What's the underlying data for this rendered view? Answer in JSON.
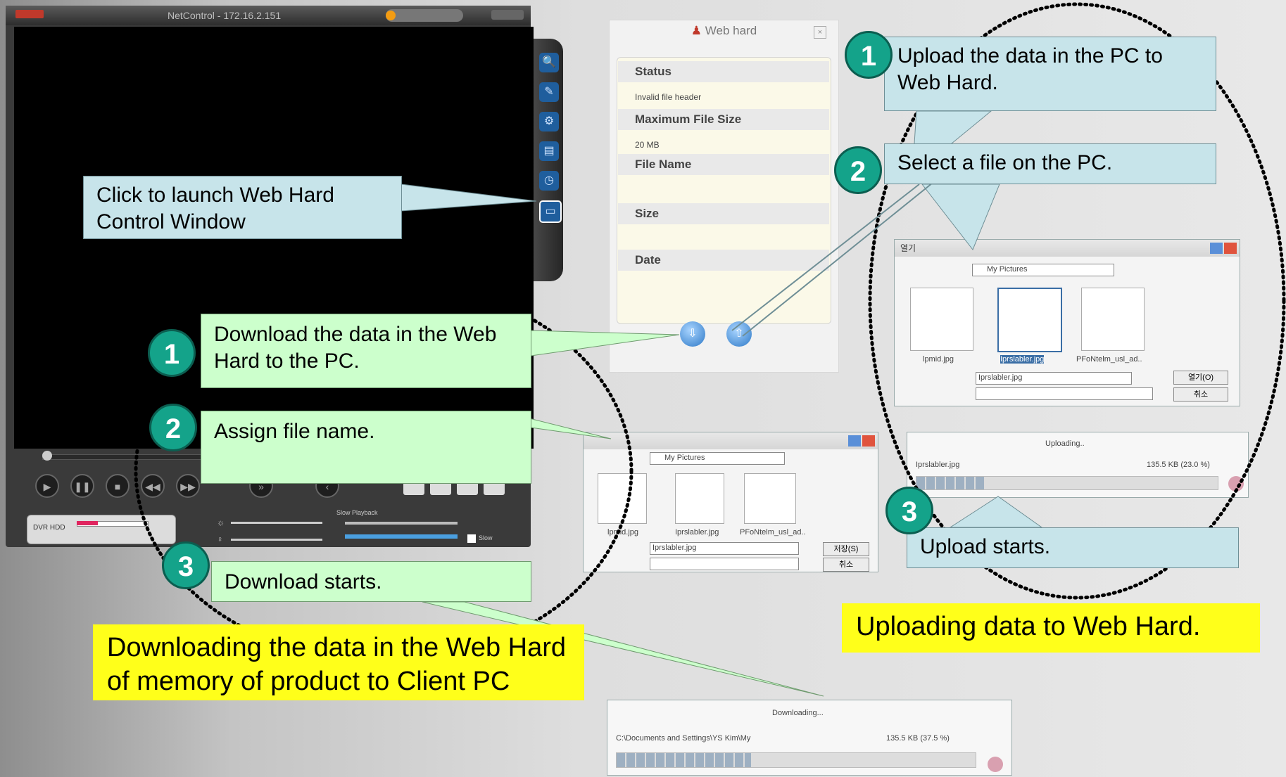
{
  "player": {
    "title": "NetControl - 172.16.2.151",
    "dvr_label": "DVR HDD",
    "eq1_label": "Slow Playback",
    "eq2_label": "Slow"
  },
  "web_hard": {
    "header": "Web hard",
    "status_label": "Status",
    "status_value": "Invalid file header",
    "max_size_label": "Maximum File Size",
    "max_size_value": "20 MB",
    "file_name_label": "File Name",
    "size_label": "Size",
    "date_label": "Date"
  },
  "upload_dialog": {
    "thumbs": [
      "lpmid.jpg",
      "Iprslabler.jpg",
      "PFoNtelm_usl_ad.."
    ],
    "filename_value": "Iprslabler.jpg",
    "open_btn": "열기(O)",
    "cancel_btn": "취소",
    "folder_value": "My Pictures"
  },
  "save_dialog": {
    "thumbs": [
      "lpmid.jpg",
      "Iprslabler.jpg",
      "PFoNtelm_usl_ad.."
    ],
    "filename_value": "Iprslabler.jpg",
    "save_btn": "저장(S)",
    "cancel_btn": "취소",
    "folder_value": "My Pictures"
  },
  "uploading_dialog": {
    "title": "Uploading..",
    "file": "Iprslabler.jpg",
    "size": "135.5 KB   (23.0 %)",
    "progress": 0.23
  },
  "downloading_dialog": {
    "title": "Downloading...",
    "file": "C:\\Documents and Settings\\YS Kim\\My",
    "size": "135.5 KB   (37.5 %)",
    "progress": 0.375
  },
  "callouts": {
    "launch": "Click to launch Web Hard Control Window",
    "upload1": "Upload the data in the PC to Web Hard.",
    "upload2": "Select a file on the PC.",
    "upload3": "Upload starts.",
    "download1": "Download the data in the Web Hard to the PC.",
    "download2": "Assign file name.",
    "download3": "Download starts."
  },
  "numbers": {
    "one": "1",
    "two": "2",
    "three": "3"
  },
  "captions": {
    "uploading": "Uploading data to Web Hard.",
    "downloading": "Downloading the data in the Web Hard of memory of product to Client PC"
  }
}
